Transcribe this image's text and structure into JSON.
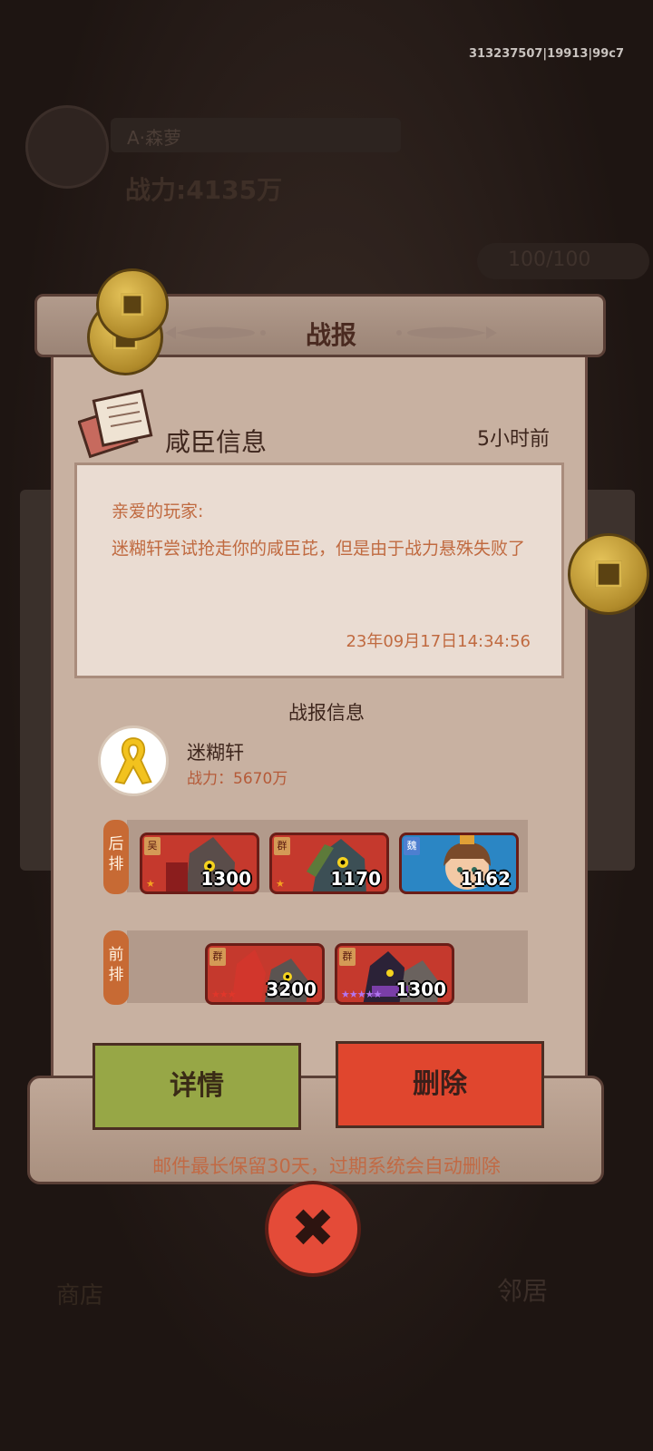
{
  "server_id": "313237507|19913|99c7",
  "background": {
    "player_name": "A·森萝",
    "power": "战力:4135万",
    "stamina": "100/100",
    "shop_label": "商店",
    "neighbor_label": "邻居"
  },
  "dialog": {
    "title": "战报",
    "mail_title": "咸臣信息",
    "mail_time": "5小时前",
    "greeting": "亲爱的玩家:",
    "message": "迷糊轩尝试抢走你的咸臣芘，但是由于战力悬殊失败了",
    "date": "23年09月17日14:34:56",
    "section_title": "战报信息",
    "attacker": {
      "name": "迷糊轩",
      "power_label": "战力：5670万"
    },
    "back_row": {
      "label": "后排",
      "units": [
        {
          "faction": "吴",
          "value": "1300",
          "stars": 1
        },
        {
          "faction": "群",
          "value": "1170",
          "stars": 1
        },
        {
          "faction": "魏",
          "value": "1162",
          "stars": 0
        }
      ]
    },
    "front_row": {
      "label": "前排",
      "units": [
        {
          "faction": "群",
          "value": "3200",
          "stars": 3
        },
        {
          "faction": "群",
          "value": "1300",
          "stars": 5
        }
      ]
    },
    "detail_button": "详情",
    "delete_button": "删除",
    "footnote": "邮件最长保留30天，过期系统会自动删除",
    "close_label": "✖"
  },
  "colors": {
    "detail_button": "#97a746",
    "delete_button": "#e0462e",
    "close_button": "#e44b38",
    "panel": "#c8b1a1",
    "accent_text": "#c06a40"
  }
}
